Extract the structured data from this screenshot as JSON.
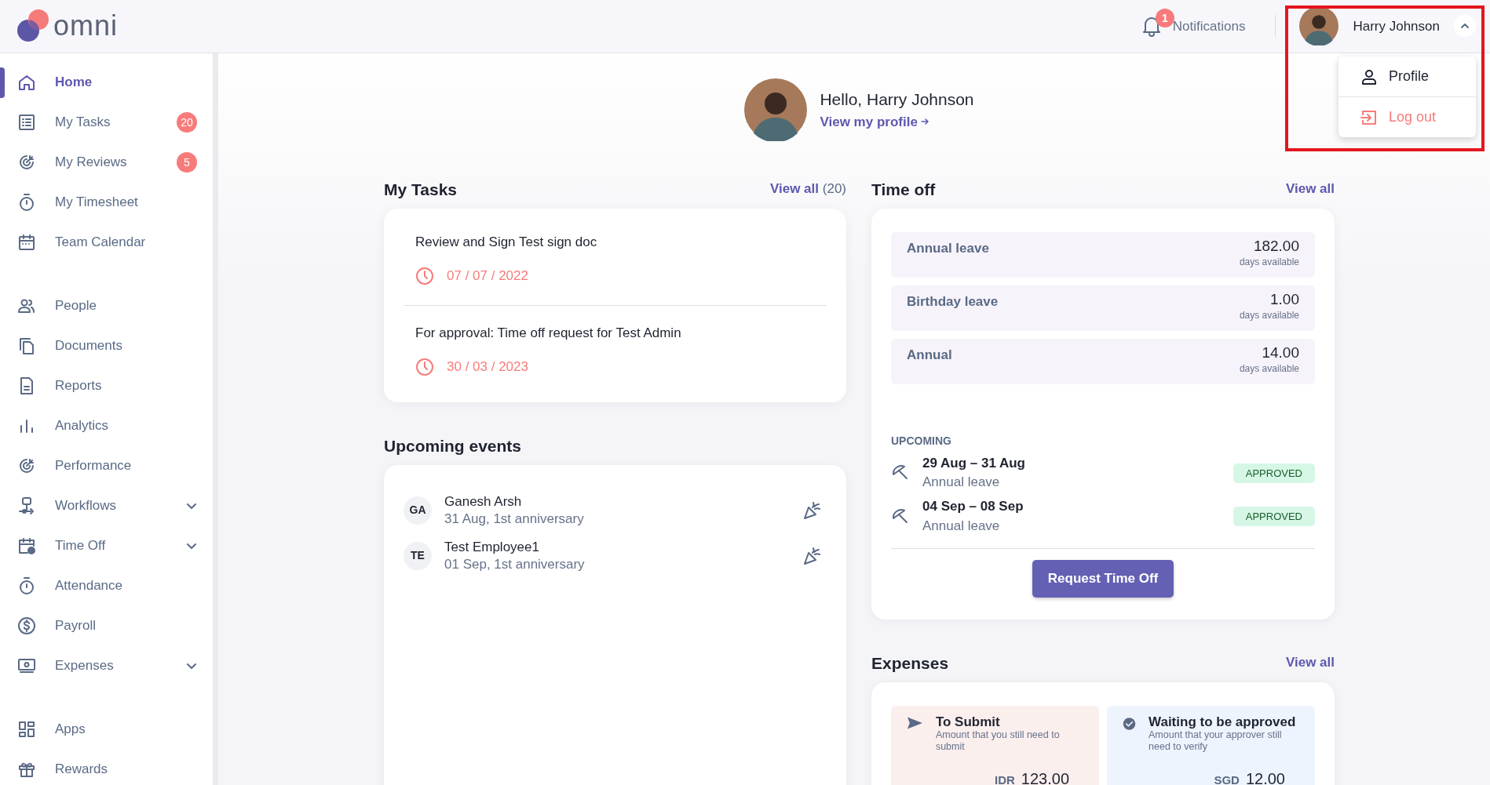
{
  "logo": {
    "text": "omni"
  },
  "header": {
    "notifications": {
      "label": "Notifications",
      "count": "1"
    },
    "user": {
      "name": "Harry Johnson",
      "expanded": true,
      "highlighted": true
    }
  },
  "user_menu": [
    {
      "kind": "profile",
      "label": "Profile"
    },
    {
      "kind": "logout",
      "label": "Log out"
    }
  ],
  "sidebar": {
    "groups": [
      [
        {
          "label": "Home",
          "selected": true,
          "expandable": false
        },
        {
          "label": "My Tasks",
          "selected": false,
          "expandable": false,
          "badge": "20"
        },
        {
          "label": "My Reviews",
          "selected": false,
          "expandable": false,
          "badge": "5"
        },
        {
          "label": "My Timesheet",
          "selected": false,
          "expandable": false
        },
        {
          "label": "Team Calendar",
          "selected": false,
          "expandable": false
        }
      ],
      [
        {
          "label": "People",
          "selected": false,
          "expandable": false
        },
        {
          "label": "Documents",
          "selected": false,
          "expandable": false
        },
        {
          "label": "Reports",
          "selected": false,
          "expandable": false
        },
        {
          "label": "Analytics",
          "selected": false,
          "expandable": false
        },
        {
          "label": "Performance",
          "selected": false,
          "expandable": false
        },
        {
          "label": "Workflows",
          "selected": false,
          "expandable": true
        },
        {
          "label": "Time Off",
          "selected": false,
          "expandable": true
        },
        {
          "label": "Attendance",
          "selected": false,
          "expandable": false
        },
        {
          "label": "Payroll",
          "selected": false,
          "expandable": false
        },
        {
          "label": "Expenses",
          "selected": false,
          "expandable": true
        }
      ],
      [
        {
          "label": "Apps",
          "selected": false,
          "expandable": false
        },
        {
          "label": "Rewards",
          "selected": false,
          "expandable": false
        }
      ]
    ]
  },
  "greeting": {
    "title": "Hello, Harry Johnson",
    "link": "View my profile"
  },
  "tasks": {
    "title": "My Tasks",
    "view_all": "View all",
    "count": "(20)",
    "items": [
      {
        "title": "Review and Sign Test sign doc",
        "due": "07 / 07 / 2022"
      },
      {
        "title": "For approval: Time off request for Test Admin",
        "due": "30 / 03 / 2023"
      }
    ]
  },
  "events": {
    "title": "Upcoming events",
    "items": [
      {
        "initials": "GA",
        "name": "Ganesh Arsh",
        "detail": "31 Aug, 1st anniversary"
      },
      {
        "initials": "TE",
        "name": "Test Employee1",
        "detail": "01 Sep, 1st anniversary"
      }
    ]
  },
  "time_off": {
    "title": "Time off",
    "view_all": "View all",
    "balances": [
      {
        "name": "Annual leave",
        "value": "182.00",
        "unit": "days available"
      },
      {
        "name": "Birthday leave",
        "value": "1.00",
        "unit": "days available"
      },
      {
        "name": "Annual",
        "value": "14.00",
        "unit": "days available"
      }
    ],
    "upcoming_label": "UPCOMING",
    "upcoming": [
      {
        "dates": "29 Aug – 31 Aug",
        "type": "Annual leave",
        "status": "APPROVED"
      },
      {
        "dates": "04 Sep – 08 Sep",
        "type": "Annual leave",
        "status": "APPROVED"
      }
    ],
    "button": "Request Time Off"
  },
  "expenses": {
    "title": "Expenses",
    "view_all": "View all",
    "cards": [
      {
        "kind": "to_submit",
        "title": "To Submit",
        "description": "Amount that you still need to submit",
        "amounts": [
          {
            "currency": "IDR",
            "value": "123.00"
          }
        ]
      },
      {
        "kind": "waiting",
        "title": "Waiting to be approved",
        "description": "Amount that your approver still need to verify",
        "amounts": [
          {
            "currency": "SGD",
            "value": "12.00"
          }
        ]
      }
    ]
  }
}
